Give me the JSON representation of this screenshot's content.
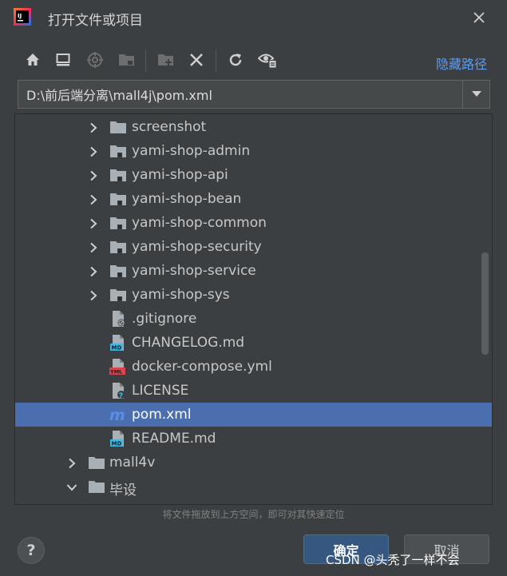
{
  "window": {
    "title": "打开文件或项目",
    "app_logo_text": "IJ"
  },
  "toolbar": {
    "buttons": [
      "home-icon",
      "desktop-icon",
      "project-directory-icon",
      "module-directory-icon",
      "new-folder-icon",
      "delete-icon",
      "refresh-icon",
      "show-hidden-files-icon"
    ],
    "hide_path_label": "隐藏路径"
  },
  "path": {
    "value": "D:\\前后端分离\\mall4j\\pom.xml"
  },
  "tree": {
    "rows": [
      {
        "label": "screenshot",
        "icon": "folder-icon",
        "expand": "collapsed"
      },
      {
        "label": "yami-shop-admin",
        "icon": "module-folder-icon",
        "expand": "collapsed"
      },
      {
        "label": "yami-shop-api",
        "icon": "module-folder-icon",
        "expand": "collapsed"
      },
      {
        "label": "yami-shop-bean",
        "icon": "module-folder-icon",
        "expand": "collapsed"
      },
      {
        "label": "yami-shop-common",
        "icon": "module-folder-icon",
        "expand": "collapsed"
      },
      {
        "label": "yami-shop-security",
        "icon": "module-folder-icon",
        "expand": "collapsed"
      },
      {
        "label": "yami-shop-service",
        "icon": "module-folder-icon",
        "expand": "collapsed"
      },
      {
        "label": "yami-shop-sys",
        "icon": "module-folder-icon",
        "expand": "collapsed"
      },
      {
        "label": ".gitignore",
        "icon": "gitignore-file-icon",
        "expand": "none"
      },
      {
        "label": "CHANGELOG.md",
        "icon": "markdown-file-icon",
        "expand": "none",
        "badge": "MD"
      },
      {
        "label": "docker-compose.yml",
        "icon": "yaml-file-icon",
        "expand": "none",
        "badge": "YML"
      },
      {
        "label": "LICENSE",
        "icon": "unknown-file-icon",
        "expand": "none"
      },
      {
        "label": "pom.xml",
        "icon": "maven-file-icon",
        "expand": "none",
        "selected": true,
        "badge": "m"
      },
      {
        "label": "README.md",
        "icon": "markdown-file-icon",
        "expand": "none",
        "badge": "MD"
      },
      {
        "label": "mall4v",
        "icon": "folder-icon",
        "expand": "collapsed"
      },
      {
        "label": "毕设",
        "icon": "folder-icon",
        "expand": "expanded"
      }
    ]
  },
  "footer": {
    "hint": "将文件拖放到上方空间，即可对其快速定位",
    "help_label": "?",
    "ok_label": "确定",
    "cancel_label": "取消"
  },
  "watermark": "CSDN @头秃了一样不会",
  "colors": {
    "background": "#3c3f41",
    "selection": "#4b6eaf",
    "link": "#589df6",
    "primary_button": "#365880"
  }
}
